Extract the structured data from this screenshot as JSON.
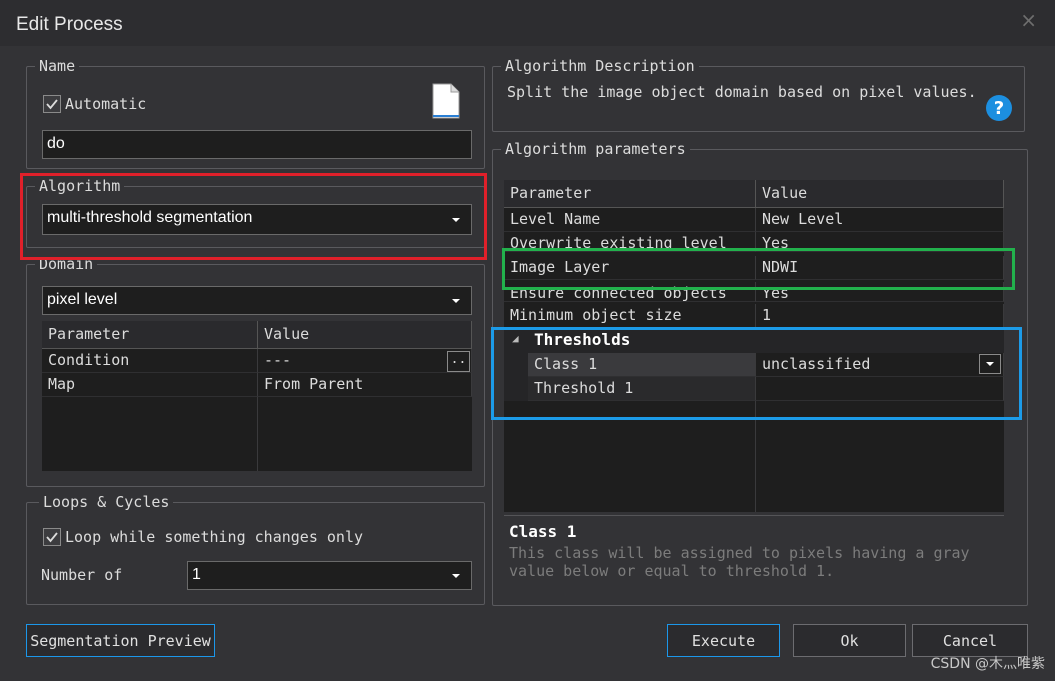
{
  "window": {
    "title": "Edit Process",
    "close_glyph": "×"
  },
  "name_group": {
    "legend": "Name",
    "automatic_label": "Automatic",
    "automatic_checked": true,
    "name_value": "do",
    "doc_icon": "document-icon"
  },
  "algorithm_group": {
    "legend": "Algorithm",
    "selected": "multi-threshold segmentation"
  },
  "domain_group": {
    "legend": "Domain",
    "selected": "pixel level",
    "columns": [
      "Parameter",
      "Value"
    ],
    "rows": [
      {
        "param": "Condition",
        "value": "---",
        "ellipsis": ".."
      },
      {
        "param": "Map",
        "value": "From Parent"
      }
    ]
  },
  "loops_group": {
    "legend": "Loops & Cycles",
    "loop_label": "Loop while something changes only",
    "loop_checked": true,
    "number_label": "Number of",
    "number_value": "1"
  },
  "description_group": {
    "legend": "Algorithm Description",
    "text": "Split the image object domain based on pixel values.",
    "help_icon": "help-icon"
  },
  "parameters_group": {
    "legend": "Algorithm parameters",
    "columns": [
      "Parameter",
      "Value"
    ],
    "rows": [
      {
        "param": "Level Name",
        "value": "New Level"
      },
      {
        "param": "Overwrite existing level",
        "value": "Yes"
      },
      {
        "param": "Image Layer",
        "value": "NDWI"
      },
      {
        "param": "Ensure connected objects",
        "value": "Yes"
      },
      {
        "param": "Minimum object size",
        "value": "1"
      }
    ],
    "thresholds_header": "Thresholds",
    "thresholds_glyph": "◢",
    "threshold_rows": [
      {
        "param": "Class 1",
        "value": "unclassified"
      },
      {
        "param": "Threshold 1",
        "value": ""
      }
    ],
    "info_title": "Class 1",
    "info_line1": "This class will be assigned to pixels having a gray",
    "info_line2": "value below or equal to threshold 1."
  },
  "buttons": {
    "preview": "Segmentation Preview",
    "execute": "Execute",
    "ok": "Ok",
    "cancel": "Cancel"
  },
  "watermark": "CSDN @木灬唯紫",
  "colors": {
    "highlight_red": "#e0202a",
    "highlight_green": "#22b14c",
    "highlight_blue": "#1c9be8"
  }
}
